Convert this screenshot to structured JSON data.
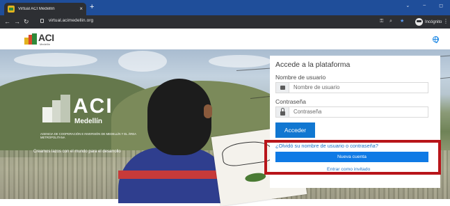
{
  "browser": {
    "tab_title": "Virtual ACI Medellín",
    "tab_close": "×",
    "new_tab": "+",
    "url": "virtual.acimedellin.org",
    "incognito_label": "Incógnito",
    "icons": [
      "back-icon",
      "forward-icon",
      "reload-icon",
      "lock-icon",
      "key-icon",
      "zoom-icon",
      "star-icon",
      "incognito-icon",
      "menu-icon"
    ]
  },
  "header": {
    "logo_text": "ACI",
    "logo_sub": "Medellín"
  },
  "hero": {
    "logo_text": "ACI",
    "logo_city": "Medellín",
    "agency": "AGENCIA DE COOPERACIÓN E INVERSIÓN DE MEDELLÍN Y EL ÁREA METROPOLITANA",
    "slogan": "Creamos lazos con el mundo para el desarrollo"
  },
  "login": {
    "title": "Accede a la plataforma",
    "username_label": "Nombre de usuario",
    "username_placeholder": "Nombre de usuario",
    "password_label": "Contraseña",
    "password_placeholder": "Contraseña",
    "submit_label": "Acceder",
    "forgot_link": "¿Olvidó su nombre de usuario o contraseña?",
    "new_account_label": "Nueva cuenta",
    "guest_link": "Entrar como invitado"
  },
  "colors": {
    "accent": "#1177d1",
    "highlight": "#b8151a",
    "tabbar": "#1f4e9a"
  }
}
